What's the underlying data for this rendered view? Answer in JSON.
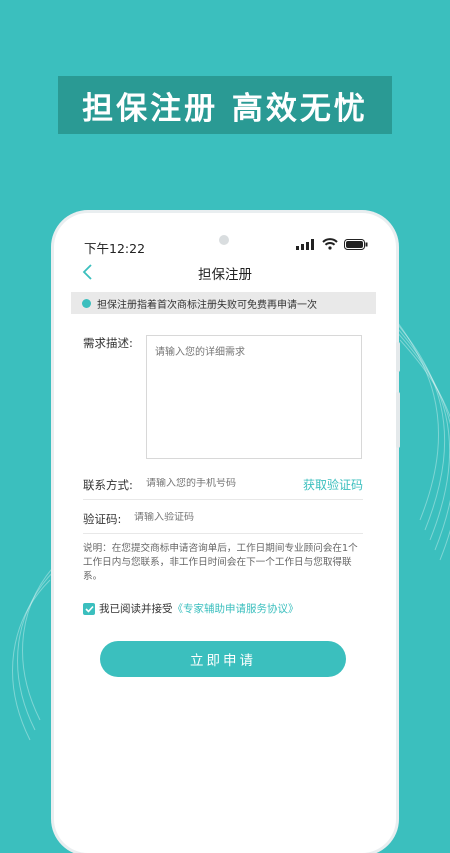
{
  "banner": {
    "title": "担保注册  高效无忧"
  },
  "status_bar": {
    "time": "下午12:22",
    "icons": [
      "signal-icon",
      "wifi-icon",
      "battery-icon"
    ]
  },
  "nav": {
    "back_icon": "chevron-left-icon",
    "title": "担保注册"
  },
  "notice": {
    "text": "担保注册指着首次商标注册失败可免费再申请一次"
  },
  "form": {
    "requirement_label": "需求描述:",
    "requirement_placeholder": "请输入您的详细需求",
    "contact_label": "联系方式:",
    "contact_placeholder": "请输入您的手机号码",
    "get_code_label": "获取验证码",
    "code_label": "验证码:",
    "code_placeholder": "请输入验证码"
  },
  "note": {
    "text": "说明：在您提交商标申请咨询单后，工作日期间专业顾问会在1个工作日内与您联系，非工作日时间会在下一个工作日与您取得联系。"
  },
  "agreement": {
    "checked": true,
    "prefix": "我已阅读并接受",
    "link": "《专家辅助申请服务协议》"
  },
  "submit": {
    "label": "立即申请"
  },
  "colors": {
    "background": "#3bbfbe",
    "banner": "#2a9a94",
    "accent": "#3bbfbe",
    "notice_bg": "#e9e9e9"
  }
}
